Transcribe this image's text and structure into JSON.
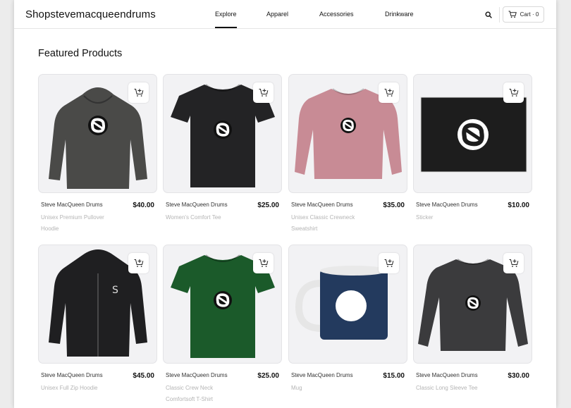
{
  "header": {
    "brand": "Shopstevemacqueendrums",
    "nav": [
      {
        "label": "Explore",
        "active": true
      },
      {
        "label": "Apparel",
        "active": false
      },
      {
        "label": "Accessories",
        "active": false
      },
      {
        "label": "Drinkware",
        "active": false
      }
    ],
    "search_icon": "search-icon",
    "cart_label": "Cart · 0"
  },
  "section": {
    "title": "Featured Products"
  },
  "products": [
    {
      "brand": "Steve MacQueen Drums",
      "name": "Unisex Premium Pullover Hoodie",
      "price": "$40.00",
      "image": "hoodie",
      "color": "#4a4a48"
    },
    {
      "brand": "Steve MacQueen Drums",
      "name": "Women's Comfort Tee",
      "price": "$25.00",
      "image": "tee",
      "color": "#232325"
    },
    {
      "brand": "Steve MacQueen Drums",
      "name": "Unisex Classic Crewneck Sweatshirt",
      "price": "$35.00",
      "image": "sweatshirt",
      "color": "#c88b95"
    },
    {
      "brand": "Steve MacQueen Drums",
      "name": "Sticker",
      "price": "$10.00",
      "image": "sticker",
      "color": "#1d1d1d"
    },
    {
      "brand": "Steve MacQueen Drums",
      "name": "Unisex Full Zip Hoodie",
      "price": "$45.00",
      "image": "zip-hoodie",
      "color": "#1f1f21"
    },
    {
      "brand": "Steve MacQueen Drums",
      "name": "Classic Crew Neck Comfortsoft T-Shirt",
      "price": "$25.00",
      "image": "tee",
      "color": "#1b5a2a"
    },
    {
      "brand": "Steve MacQueen Drums",
      "name": "Mug",
      "price": "$15.00",
      "image": "mug",
      "color": "#233a5e"
    },
    {
      "brand": "Steve MacQueen Drums",
      "name": "Classic Long Sleeve Tee",
      "price": "$30.00",
      "image": "longsleeve",
      "color": "#3b3b3d"
    }
  ]
}
